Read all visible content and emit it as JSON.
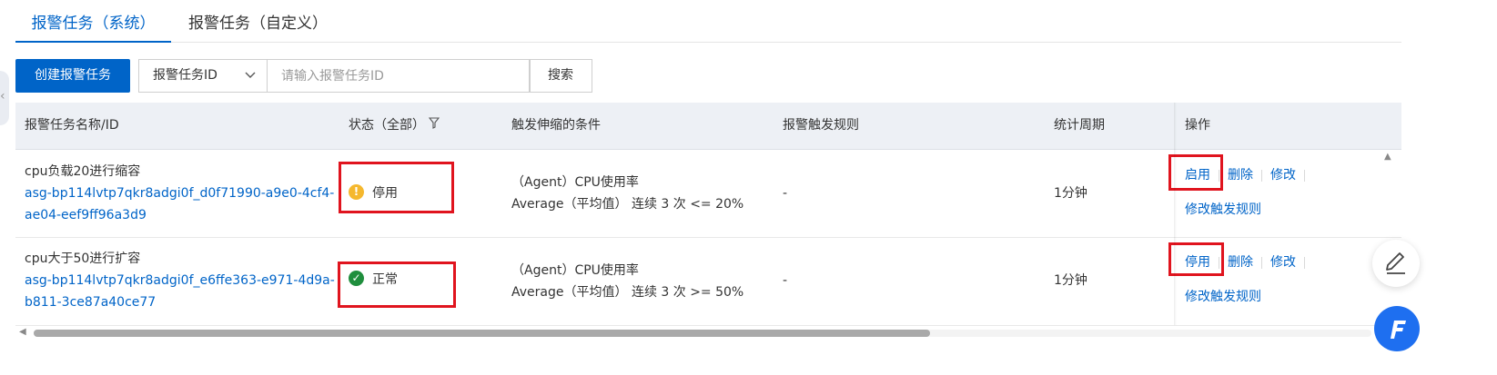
{
  "tabs": [
    {
      "label": "报警任务（系统）",
      "active": true
    },
    {
      "label": "报警任务（自定义）",
      "active": false
    }
  ],
  "toolbar": {
    "create_label": "创建报警任务",
    "search_field": "报警任务ID",
    "search_placeholder": "请输入报警任务ID",
    "search_label": "搜索"
  },
  "table": {
    "headers": {
      "name": "报警任务名称/ID",
      "status": "状态（全部）",
      "condition": "触发伸缩的条件",
      "rule": "报警触发规则",
      "period": "统计周期",
      "ops": "操作"
    },
    "rows": [
      {
        "name": "cpu负载20进行缩容",
        "id_line1": "asg-bp114lvtp7qkr8adgi0f_d0f71990-a9e0-4cf4-",
        "id_line2": "ae04-eef9ff96a3d9",
        "status": "停用",
        "cond_line1": "（Agent）CPU使用率",
        "cond_line2": "Average（平均值） 连续 3 次 <= 20%",
        "rule": "-",
        "period": "1分钟",
        "op_toggle": "启用",
        "op_delete": "删除",
        "op_edit": "修改",
        "op_edit_rule": "修改触发规则"
      },
      {
        "name": "cpu大于50进行扩容",
        "id_line1": "asg-bp114lvtp7qkr8adgi0f_e6ffe363-e971-4d9a-",
        "id_line2": "b811-3ce87a40ce77",
        "status": "正常",
        "cond_line1": "（Agent）CPU使用率",
        "cond_line2": "Average（平均值） 连续 3 次 >= 50%",
        "rule": "-",
        "period": "1分钟",
        "op_toggle": "停用",
        "op_delete": "删除",
        "op_edit": "修改",
        "op_edit_rule": "修改触发规则"
      }
    ]
  },
  "colors": {
    "primary": "#0064c8",
    "highlight_box": "#e0141e",
    "status_warning": "#f5b82e",
    "status_ok": "#1f8e3d",
    "header_bg": "#edf0f5"
  },
  "icons": {
    "filter": "filter-icon",
    "dropdown": "chevron-down-icon",
    "status_stopped": "warning-icon",
    "status_normal": "check-circle-icon",
    "float_edit": "edit-icon",
    "float_brand": "brand-logo-icon"
  },
  "horizontal_scroll_fraction": 0.67
}
